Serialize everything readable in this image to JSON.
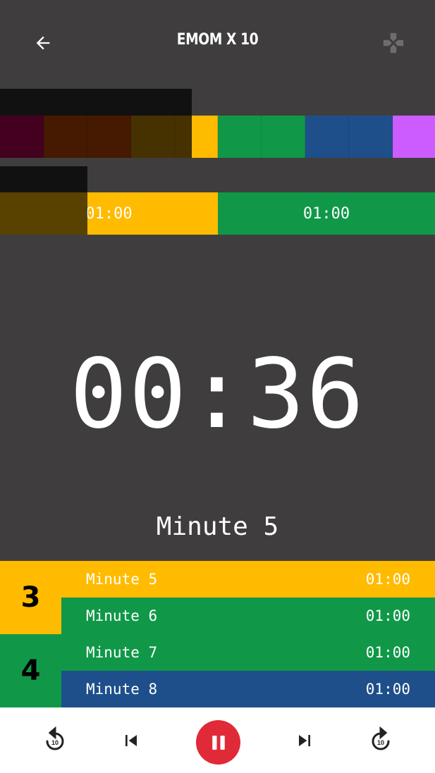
{
  "header": {
    "title": "EMOM X 10",
    "back_icon": "arrow-left-icon",
    "gamepad_icon": "gamepad-icon"
  },
  "overview": {
    "segment_colors": [
      "#43001f",
      "#451a00",
      "#451a00",
      "#453200",
      "#453200",
      "#ffbb00",
      "#109848",
      "#109848",
      "#1e4f8a",
      "#1e4f8a",
      "#cc5cff"
    ]
  },
  "current_bar": {
    "segments": [
      {
        "label": "01:00",
        "color": "#ffbb00"
      },
      {
        "label": "01:00",
        "color": "#109848"
      }
    ]
  },
  "timer": {
    "display": "00:36",
    "current_label": "Minute 5"
  },
  "list": {
    "rounds": [
      {
        "number": "3",
        "color": "#ffbb00"
      },
      {
        "number": "4",
        "color": "#109848"
      }
    ],
    "rows": [
      {
        "name": "Minute 5",
        "time": "01:00",
        "color": "#ffbb00"
      },
      {
        "name": "Minute 6",
        "time": "01:00",
        "color": "#109848"
      },
      {
        "name": "Minute 7",
        "time": "01:00",
        "color": "#109848"
      },
      {
        "name": "Minute 8",
        "time": "01:00",
        "color": "#1e4f8a"
      }
    ]
  },
  "controls": {
    "rewind_label": "10",
    "forward_label": "10",
    "rewind_icon": "replay-10-icon",
    "previous_icon": "skip-previous-icon",
    "pause_icon": "pause-icon",
    "next_icon": "skip-next-icon",
    "forward_icon": "forward-10-icon",
    "pause_color": "#e02a38"
  }
}
